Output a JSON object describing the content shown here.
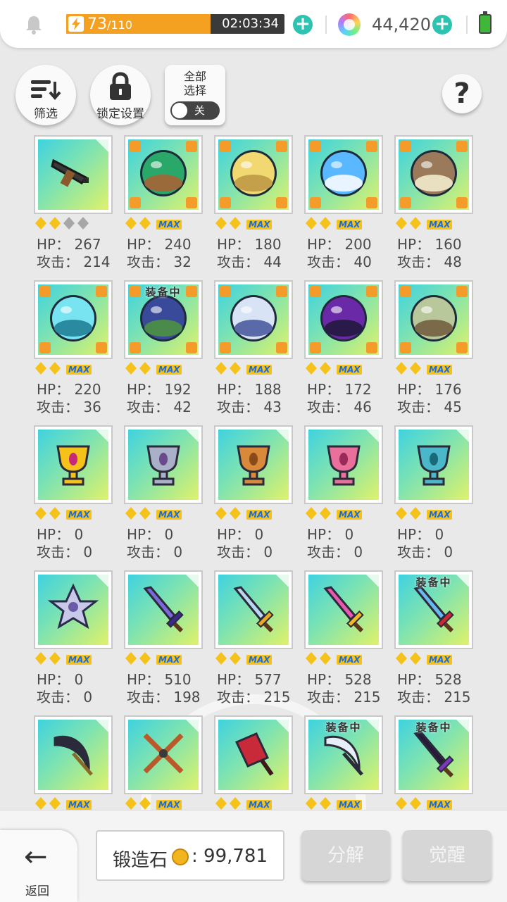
{
  "status": {
    "energy_current": "73",
    "energy_max": "/110",
    "energy_fraction": 0.66,
    "timer": "02:03:34",
    "gems": "44,420"
  },
  "controls": {
    "filter_label": "筛选",
    "lock_label": "锁定设置",
    "select_all_label": "全部\n选择",
    "toggle_state": "关",
    "help_label": "?"
  },
  "items": [
    {
      "art": "rifle",
      "hp": "HP： 267",
      "atk": "攻击： 214",
      "stars": 2,
      "max": false,
      "equipped": false
    },
    {
      "art": "orb-green",
      "hp": "HP： 240",
      "atk": "攻击： 32",
      "stars": 2,
      "max": true,
      "equipped": false
    },
    {
      "art": "orb-sand",
      "hp": "HP： 180",
      "atk": "攻击： 44",
      "stars": 2,
      "max": true,
      "equipped": false
    },
    {
      "art": "orb-sky",
      "hp": "HP： 200",
      "atk": "攻击： 40",
      "stars": 2,
      "max": true,
      "equipped": false
    },
    {
      "art": "orb-brown",
      "hp": "HP： 160",
      "atk": "攻击： 48",
      "stars": 2,
      "max": true,
      "equipped": false
    },
    {
      "art": "orb-ice",
      "hp": "HP： 220",
      "atk": "攻击： 36",
      "stars": 2,
      "max": true,
      "equipped": false
    },
    {
      "art": "orb-night",
      "hp": "HP： 192",
      "atk": "攻击： 42",
      "stars": 2,
      "max": true,
      "equipped": true
    },
    {
      "art": "orb-white",
      "hp": "HP： 188",
      "atk": "攻击： 43",
      "stars": 2,
      "max": true,
      "equipped": false
    },
    {
      "art": "orb-purple",
      "hp": "HP： 172",
      "atk": "攻击： 46",
      "stars": 2,
      "max": true,
      "equipped": false
    },
    {
      "art": "orb-ruin",
      "hp": "HP： 176",
      "atk": "攻击： 45",
      "stars": 2,
      "max": true,
      "equipped": false
    },
    {
      "art": "trophy-gold",
      "hp": "HP： 0",
      "atk": "攻击： 0",
      "stars": 2,
      "max": true,
      "equipped": false
    },
    {
      "art": "trophy-silver",
      "hp": "HP： 0",
      "atk": "攻击： 0",
      "stars": 2,
      "max": true,
      "equipped": false
    },
    {
      "art": "trophy-bronze",
      "hp": "HP： 0",
      "atk": "攻击： 0",
      "stars": 2,
      "max": true,
      "equipped": false
    },
    {
      "art": "trophy-pink",
      "hp": "HP： 0",
      "atk": "攻击： 0",
      "stars": 2,
      "max": true,
      "equipped": false
    },
    {
      "art": "trophy-teal",
      "hp": "HP： 0",
      "atk": "攻击： 0",
      "stars": 2,
      "max": true,
      "equipped": false
    },
    {
      "art": "emblem",
      "hp": "HP： 0",
      "atk": "攻击： 0",
      "stars": 2,
      "max": true,
      "equipped": false
    },
    {
      "art": "sword-purple",
      "hp": "HP： 510",
      "atk": "攻击： 198",
      "stars": 2,
      "max": true,
      "equipped": false
    },
    {
      "art": "sword-gold",
      "hp": "HP： 577",
      "atk": "攻击： 215",
      "stars": 2,
      "max": true,
      "equipped": false
    },
    {
      "art": "sword-rainbow",
      "hp": "HP： 528",
      "atk": "攻击： 215",
      "stars": 2,
      "max": true,
      "equipped": false
    },
    {
      "art": "sword-blue",
      "hp": "HP： 528",
      "atk": "攻击： 215",
      "stars": 2,
      "max": true,
      "equipped": true
    },
    {
      "art": "scythe",
      "hp": "",
      "atk": "",
      "stars": 2,
      "max": true,
      "equipped": false
    },
    {
      "art": "crossed-blades",
      "hp": "",
      "atk": "",
      "stars": 2,
      "max": true,
      "equipped": false
    },
    {
      "art": "cleaver",
      "hp": "",
      "atk": "",
      "stars": 2,
      "max": true,
      "equipped": false
    },
    {
      "art": "scimitar",
      "hp": "",
      "atk": "",
      "stars": 2,
      "max": true,
      "equipped": true
    },
    {
      "art": "dark-sword",
      "hp": "",
      "atk": "",
      "stars": 2,
      "max": true,
      "equipped": true
    }
  ],
  "labels": {
    "equipped": "装备中",
    "max": "MAX"
  },
  "bottom": {
    "back_label": "返回",
    "stones_label": "锻造石",
    "stones_value": ": 99,781",
    "disassemble_label": "分解",
    "awaken_label": "觉醒"
  },
  "colors": {
    "accent": "#2ec3b0",
    "energy": "#f4a020",
    "star": "#f5c21a",
    "orb_corner": "#f49b2a"
  }
}
